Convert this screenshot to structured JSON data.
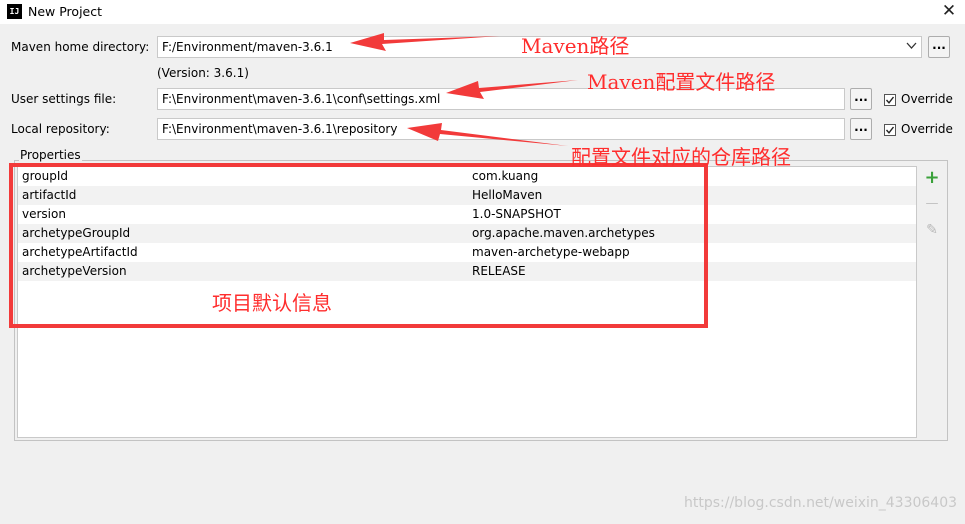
{
  "window": {
    "title": "New Project",
    "app_icon_text": "IJ",
    "close_glyph": "✕"
  },
  "maven_home": {
    "label": "Maven home directory:",
    "value": "F:/Environment/maven-3.6.1",
    "version_note": "(Version: 3.6.1)",
    "browse_label": "..."
  },
  "user_settings": {
    "label": "User settings file:",
    "value": "F:\\Environment\\maven-3.6.1\\conf\\settings.xml",
    "browse_label": "...",
    "override_label": "Override",
    "override_checked": true
  },
  "local_repo": {
    "label": "Local repository:",
    "value": "F:\\Environment\\maven-3.6.1\\repository",
    "browse_label": "...",
    "override_label": "Override",
    "override_checked": true
  },
  "properties": {
    "group_label": "Properties",
    "rows": [
      {
        "key": "groupId",
        "value": "com.kuang"
      },
      {
        "key": "artifactId",
        "value": "HelloMaven"
      },
      {
        "key": "version",
        "value": "1.0-SNAPSHOT"
      },
      {
        "key": "archetypeGroupId",
        "value": "org.apache.maven.archetypes"
      },
      {
        "key": "archetypeArtifactId",
        "value": "maven-archetype-webapp"
      },
      {
        "key": "archetypeVersion",
        "value": "RELEASE"
      }
    ],
    "add_glyph": "+",
    "remove_glyph": "—",
    "edit_glyph": "✎"
  },
  "annotations": {
    "maven_path": "Maven路径",
    "maven_config": "Maven配置文件路径",
    "repo_path": "配置文件对应的仓库路径",
    "defaults": "项目默认信息",
    "color": "#ff2d2d"
  },
  "watermark": "https://blog.csdn.net/weixin_43306403"
}
